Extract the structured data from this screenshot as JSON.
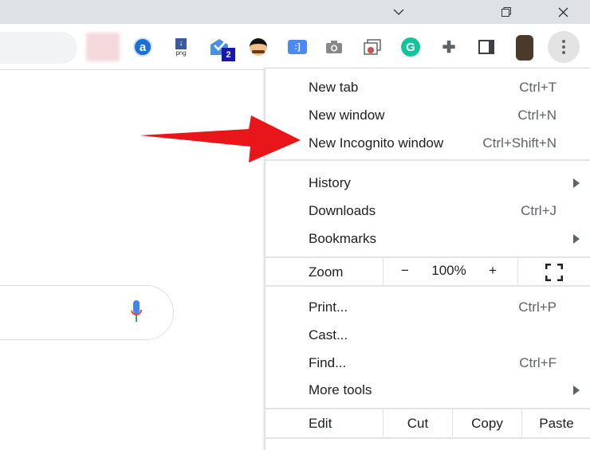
{
  "window": {
    "minimize_icon": "chevron-down-icon",
    "restore_icon": "restore-icon",
    "close_icon": "close-icon"
  },
  "extensions": {
    "grammarly_badge": "2",
    "png_label": "png"
  },
  "menu": {
    "group1": [
      {
        "label": "New tab",
        "shortcut": "Ctrl+T"
      },
      {
        "label": "New window",
        "shortcut": "Ctrl+N"
      },
      {
        "label": "New Incognito window",
        "shortcut": "Ctrl+Shift+N"
      }
    ],
    "group2": [
      {
        "label": "History"
      },
      {
        "label": "Downloads",
        "shortcut": "Ctrl+J"
      },
      {
        "label": "Bookmarks"
      }
    ],
    "zoom": {
      "label": "Zoom",
      "minus": "−",
      "value": "100%",
      "plus": "+"
    },
    "group3": [
      {
        "label": "Print...",
        "shortcut": "Ctrl+P"
      },
      {
        "label": "Cast..."
      },
      {
        "label": "Find...",
        "shortcut": "Ctrl+F"
      },
      {
        "label": "More tools"
      }
    ],
    "edit": {
      "label": "Edit",
      "cut": "Cut",
      "copy": "Copy",
      "paste": "Paste"
    }
  },
  "colors": {
    "arrow": "#e8161b",
    "accent": "#1a73e8"
  }
}
